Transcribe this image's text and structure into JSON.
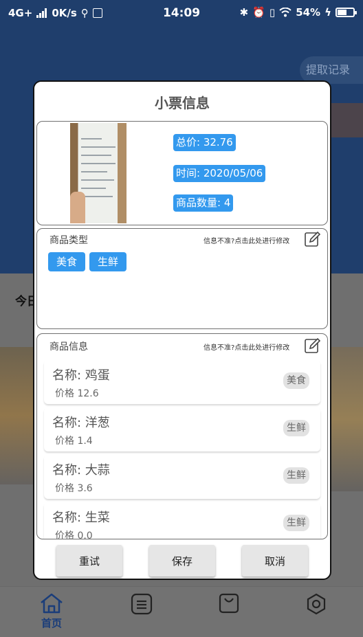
{
  "status_bar": {
    "network": "4G+",
    "speed": "0K/s",
    "time": "14:09",
    "battery": "54%"
  },
  "background": {
    "extract_records": "提取记录",
    "today_label": "今日"
  },
  "tab_bar": {
    "tabs": [
      {
        "label": "首页",
        "icon": "home-icon",
        "active": true
      },
      {
        "label": "",
        "icon": "list-icon",
        "active": false
      },
      {
        "label": "",
        "icon": "bag-icon",
        "active": false
      },
      {
        "label": "",
        "icon": "settings-hex-icon",
        "active": false
      }
    ]
  },
  "dialog": {
    "title": "小票信息",
    "summary": {
      "total": "总价: 32.76",
      "time": "时间: 2020/05/06",
      "count": "商品数量: 4"
    },
    "types_section": {
      "label": "商品类型",
      "edit_hint": "信息不准?点击此处进行修改",
      "tags": [
        "美食",
        "生鲜"
      ]
    },
    "goods_section": {
      "label": "商品信息",
      "edit_hint": "信息不准?点击此处进行修改",
      "items": [
        {
          "name": "名称: 鸡蛋",
          "price": "价格 12.6",
          "tag": "美食"
        },
        {
          "name": "名称: 洋葱",
          "price": "价格 1.4",
          "tag": "生鲜"
        },
        {
          "name": "名称: 大蒜",
          "price": "价格 3.6",
          "tag": "生鲜"
        },
        {
          "name": "名称: 生菜",
          "price": "价格 0.0",
          "tag": "生鲜"
        }
      ]
    },
    "buttons": {
      "retry": "重试",
      "save": "保存",
      "cancel": "取消"
    }
  },
  "colors": {
    "accent": "#3399ee",
    "header_bg": "#1f3e6c",
    "overlay_bg": "#6f6f6f"
  }
}
